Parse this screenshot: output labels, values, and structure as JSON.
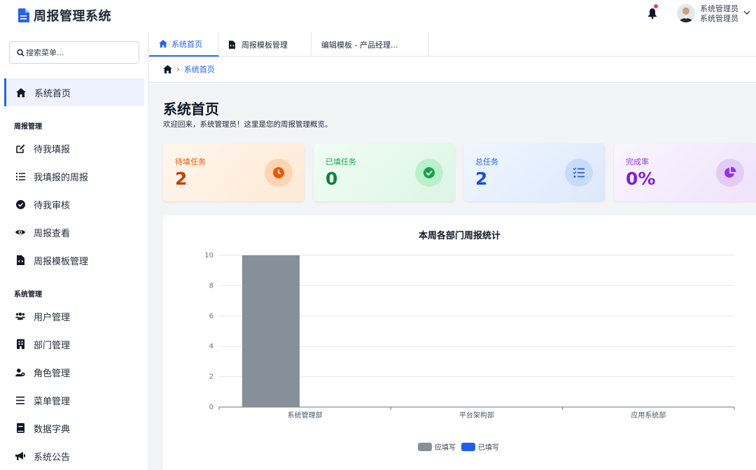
{
  "app": {
    "title": "周报管理系统"
  },
  "user": {
    "name": "系统管理员",
    "role": "系统管理员"
  },
  "sidebar": {
    "search_placeholder": "搜索菜单...",
    "home": "系统首页",
    "groups": [
      {
        "title": "周报管理",
        "items": [
          "待我填报",
          "我填报的周报",
          "待我审核",
          "周报查看",
          "周报模板管理"
        ]
      },
      {
        "title": "系统管理",
        "items": [
          "用户管理",
          "部门管理",
          "角色管理",
          "菜单管理",
          "数据字典",
          "系统公告"
        ]
      }
    ]
  },
  "tabs": [
    "系统首页",
    "周报模板管理",
    "编辑模板 - 产品经理..."
  ],
  "breadcrumb": {
    "current": "系统首页"
  },
  "page": {
    "title": "系统首页",
    "subtitle": "欢迎回来，系统管理员！这里是您的周报管理概览。"
  },
  "stats": [
    {
      "label": "待填任务",
      "value": "2",
      "color": "#c2410c",
      "icon": "clock-icon"
    },
    {
      "label": "已填任务",
      "value": "0",
      "color": "#15803d",
      "icon": "check-circle-icon"
    },
    {
      "label": "总任务",
      "value": "2",
      "color": "#1d4ed8",
      "icon": "task-list-icon"
    },
    {
      "label": "完成率",
      "value": "0%",
      "color": "#7e22ce",
      "icon": "pie-chart-icon"
    }
  ],
  "chart_data": {
    "type": "bar",
    "title": "本周各部门周报统计",
    "categories": [
      "系统管理部",
      "平台架构部",
      "应用系统部"
    ],
    "series": [
      {
        "name": "应填写",
        "values": [
          10,
          0,
          0
        ],
        "color": "#878f99"
      },
      {
        "name": "已填写",
        "values": [
          0,
          0,
          0
        ],
        "color": "#1e5eea"
      }
    ],
    "ylim": [
      0,
      10
    ],
    "yticks": [
      0,
      2,
      4,
      6,
      8,
      10
    ],
    "grid": true,
    "legend_position": "bottom"
  }
}
